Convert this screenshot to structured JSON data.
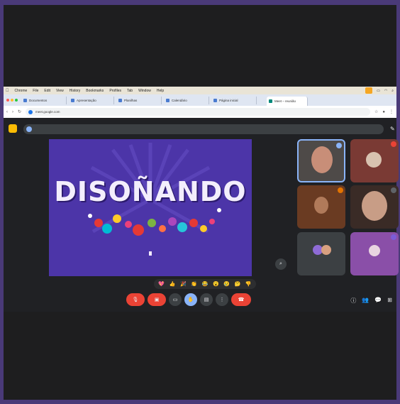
{
  "menubar": {
    "items": [
      "Chrome",
      "File",
      "Edit",
      "View",
      "History",
      "Bookmarks",
      "Profiles",
      "Tab",
      "Window",
      "Help"
    ]
  },
  "tabs": [
    "Meet – reunião",
    "Documentos",
    "Apresentação",
    "Planilhas",
    "Calendário",
    "Página inicial"
  ],
  "address": {
    "url": "meet.google.com"
  },
  "notice": {
    "text": ""
  },
  "slide": {
    "title": "DISOÑANDO",
    "line1": "",
    "line2_before": "",
    "line2_highlight": "",
    "line2_after": ""
  },
  "participants": [
    {
      "name": "",
      "speaking": true
    },
    {
      "name": "",
      "badge_color": "#ea4335"
    },
    {
      "name": "",
      "badge_color": "#e37400"
    },
    {
      "name": ""
    },
    {
      "name": ""
    },
    {
      "name": "",
      "badge_color": "#7b5cd6"
    }
  ],
  "reactions": [
    "💖",
    "👍",
    "🎉",
    "👏",
    "😂",
    "😮",
    "😢",
    "🤔",
    "👎"
  ],
  "meeting_info": {
    "time": "",
    "code": ""
  },
  "colors": {
    "accent": "#8ab4f8",
    "end_call": "#ea4335",
    "slide_bg": "#4c35a8"
  }
}
